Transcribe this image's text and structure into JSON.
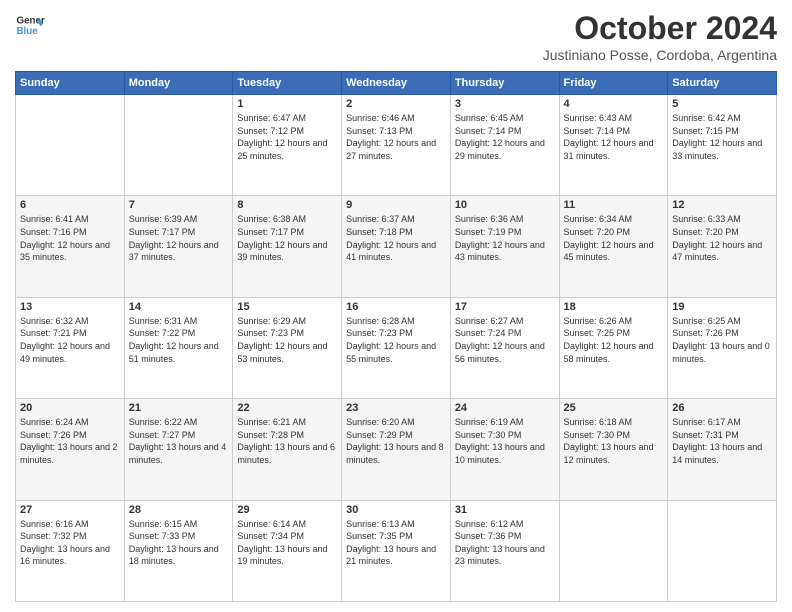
{
  "header": {
    "logo_line1": "General",
    "logo_line2": "Blue",
    "title": "October 2024",
    "subtitle": "Justiniano Posse, Cordoba, Argentina"
  },
  "days_of_week": [
    "Sunday",
    "Monday",
    "Tuesday",
    "Wednesday",
    "Thursday",
    "Friday",
    "Saturday"
  ],
  "weeks": [
    [
      {
        "day": "",
        "info": ""
      },
      {
        "day": "",
        "info": ""
      },
      {
        "day": "1",
        "info": "Sunrise: 6:47 AM\nSunset: 7:12 PM\nDaylight: 12 hours and 25 minutes."
      },
      {
        "day": "2",
        "info": "Sunrise: 6:46 AM\nSunset: 7:13 PM\nDaylight: 12 hours and 27 minutes."
      },
      {
        "day": "3",
        "info": "Sunrise: 6:45 AM\nSunset: 7:14 PM\nDaylight: 12 hours and 29 minutes."
      },
      {
        "day": "4",
        "info": "Sunrise: 6:43 AM\nSunset: 7:14 PM\nDaylight: 12 hours and 31 minutes."
      },
      {
        "day": "5",
        "info": "Sunrise: 6:42 AM\nSunset: 7:15 PM\nDaylight: 12 hours and 33 minutes."
      }
    ],
    [
      {
        "day": "6",
        "info": "Sunrise: 6:41 AM\nSunset: 7:16 PM\nDaylight: 12 hours and 35 minutes."
      },
      {
        "day": "7",
        "info": "Sunrise: 6:39 AM\nSunset: 7:17 PM\nDaylight: 12 hours and 37 minutes."
      },
      {
        "day": "8",
        "info": "Sunrise: 6:38 AM\nSunset: 7:17 PM\nDaylight: 12 hours and 39 minutes."
      },
      {
        "day": "9",
        "info": "Sunrise: 6:37 AM\nSunset: 7:18 PM\nDaylight: 12 hours and 41 minutes."
      },
      {
        "day": "10",
        "info": "Sunrise: 6:36 AM\nSunset: 7:19 PM\nDaylight: 12 hours and 43 minutes."
      },
      {
        "day": "11",
        "info": "Sunrise: 6:34 AM\nSunset: 7:20 PM\nDaylight: 12 hours and 45 minutes."
      },
      {
        "day": "12",
        "info": "Sunrise: 6:33 AM\nSunset: 7:20 PM\nDaylight: 12 hours and 47 minutes."
      }
    ],
    [
      {
        "day": "13",
        "info": "Sunrise: 6:32 AM\nSunset: 7:21 PM\nDaylight: 12 hours and 49 minutes."
      },
      {
        "day": "14",
        "info": "Sunrise: 6:31 AM\nSunset: 7:22 PM\nDaylight: 12 hours and 51 minutes."
      },
      {
        "day": "15",
        "info": "Sunrise: 6:29 AM\nSunset: 7:23 PM\nDaylight: 12 hours and 53 minutes."
      },
      {
        "day": "16",
        "info": "Sunrise: 6:28 AM\nSunset: 7:23 PM\nDaylight: 12 hours and 55 minutes."
      },
      {
        "day": "17",
        "info": "Sunrise: 6:27 AM\nSunset: 7:24 PM\nDaylight: 12 hours and 56 minutes."
      },
      {
        "day": "18",
        "info": "Sunrise: 6:26 AM\nSunset: 7:25 PM\nDaylight: 12 hours and 58 minutes."
      },
      {
        "day": "19",
        "info": "Sunrise: 6:25 AM\nSunset: 7:26 PM\nDaylight: 13 hours and 0 minutes."
      }
    ],
    [
      {
        "day": "20",
        "info": "Sunrise: 6:24 AM\nSunset: 7:26 PM\nDaylight: 13 hours and 2 minutes."
      },
      {
        "day": "21",
        "info": "Sunrise: 6:22 AM\nSunset: 7:27 PM\nDaylight: 13 hours and 4 minutes."
      },
      {
        "day": "22",
        "info": "Sunrise: 6:21 AM\nSunset: 7:28 PM\nDaylight: 13 hours and 6 minutes."
      },
      {
        "day": "23",
        "info": "Sunrise: 6:20 AM\nSunset: 7:29 PM\nDaylight: 13 hours and 8 minutes."
      },
      {
        "day": "24",
        "info": "Sunrise: 6:19 AM\nSunset: 7:30 PM\nDaylight: 13 hours and 10 minutes."
      },
      {
        "day": "25",
        "info": "Sunrise: 6:18 AM\nSunset: 7:30 PM\nDaylight: 13 hours and 12 minutes."
      },
      {
        "day": "26",
        "info": "Sunrise: 6:17 AM\nSunset: 7:31 PM\nDaylight: 13 hours and 14 minutes."
      }
    ],
    [
      {
        "day": "27",
        "info": "Sunrise: 6:16 AM\nSunset: 7:32 PM\nDaylight: 13 hours and 16 minutes."
      },
      {
        "day": "28",
        "info": "Sunrise: 6:15 AM\nSunset: 7:33 PM\nDaylight: 13 hours and 18 minutes."
      },
      {
        "day": "29",
        "info": "Sunrise: 6:14 AM\nSunset: 7:34 PM\nDaylight: 13 hours and 19 minutes."
      },
      {
        "day": "30",
        "info": "Sunrise: 6:13 AM\nSunset: 7:35 PM\nDaylight: 13 hours and 21 minutes."
      },
      {
        "day": "31",
        "info": "Sunrise: 6:12 AM\nSunset: 7:36 PM\nDaylight: 13 hours and 23 minutes."
      },
      {
        "day": "",
        "info": ""
      },
      {
        "day": "",
        "info": ""
      }
    ]
  ]
}
